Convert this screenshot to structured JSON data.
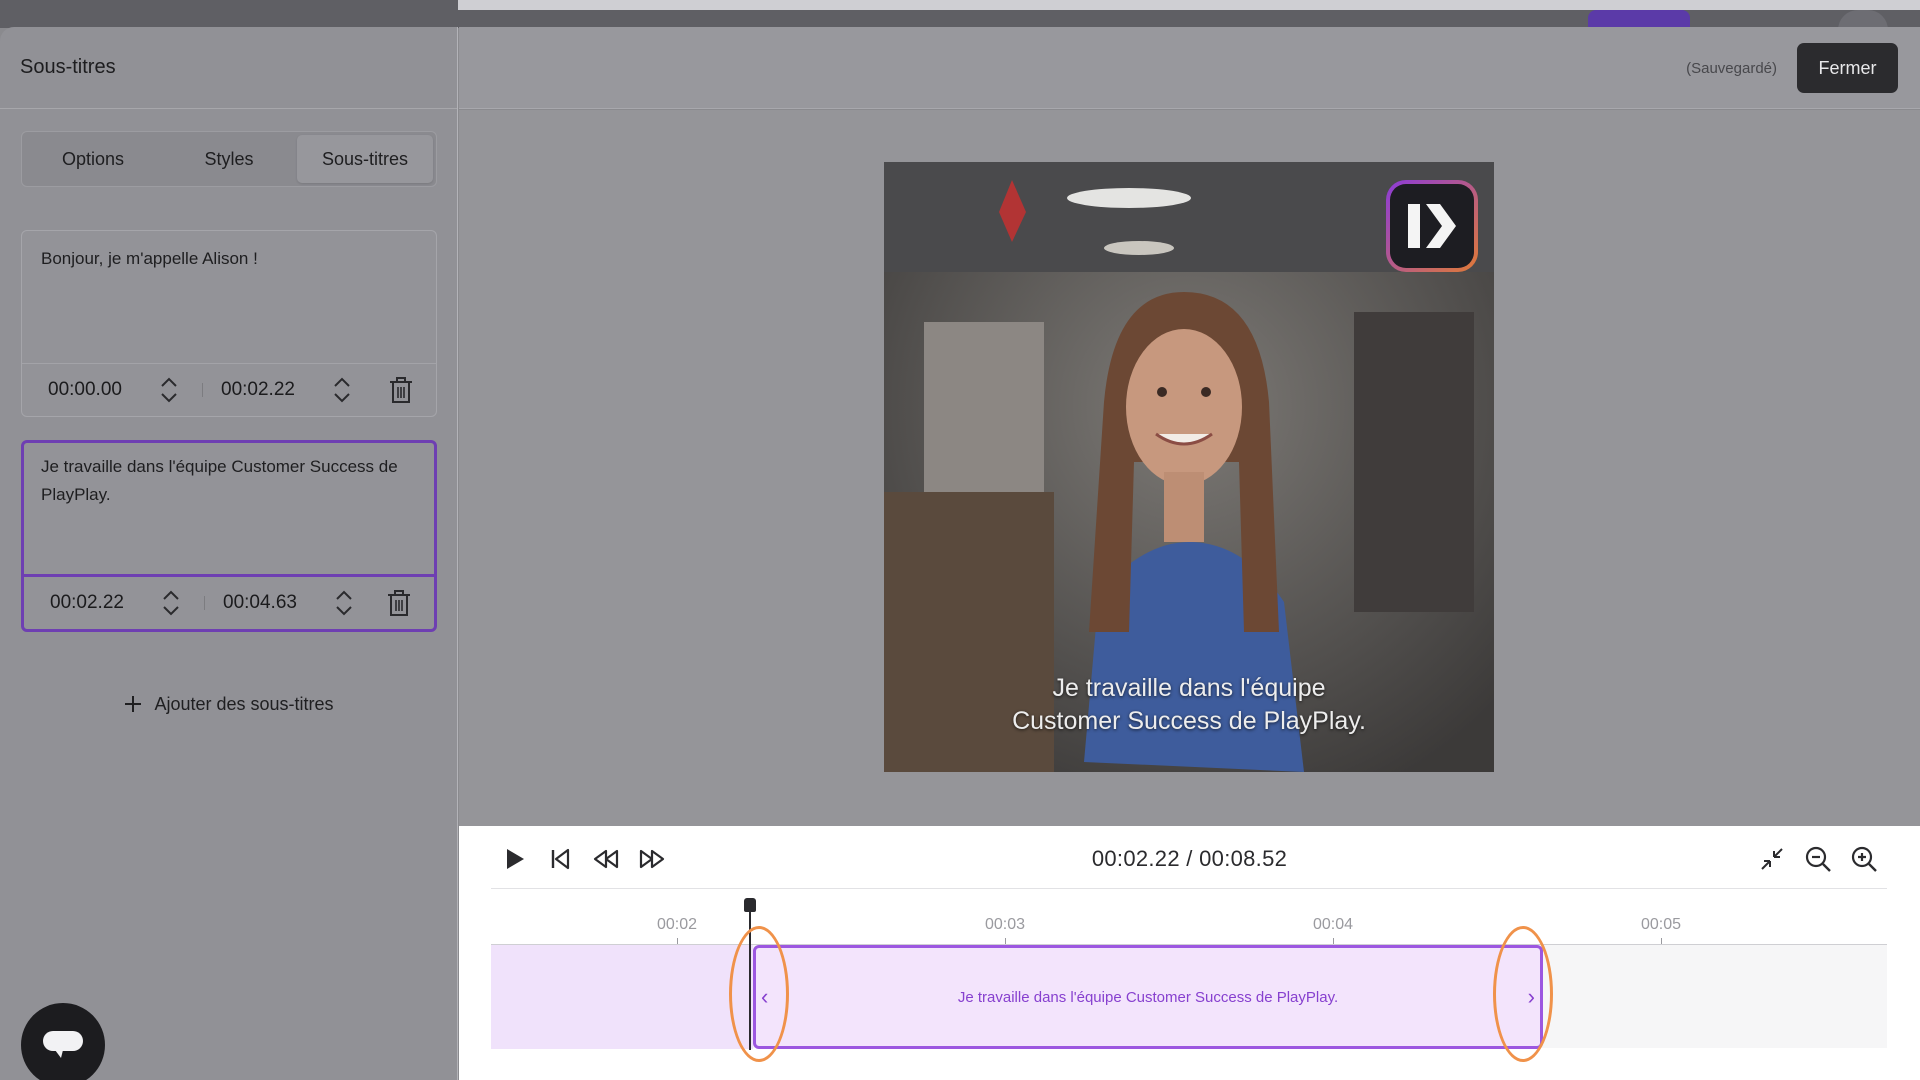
{
  "header": {
    "panel_title": "Sous-titres",
    "saved_status": "(Sauvegardé)",
    "close_label": "Fermer"
  },
  "tabs": [
    {
      "label": "Options",
      "active": false
    },
    {
      "label": "Styles",
      "active": false
    },
    {
      "label": "Sous-titres",
      "active": true
    }
  ],
  "subtitles": [
    {
      "text": "Bonjour, je m'appelle Alison !",
      "start": "00:00.00",
      "end": "00:02.22",
      "selected": false
    },
    {
      "text": "Je travaille dans l'équipe Customer Success de PlayPlay.",
      "start": "00:02.22",
      "end": "00:04.63",
      "selected": true
    }
  ],
  "add_subtitles_label": "Ajouter des sous-titres",
  "video": {
    "caption_line1": "Je travaille dans l'équipe",
    "caption_line2": "Customer Success de PlayPlay.",
    "logo": "playplay-logo"
  },
  "player": {
    "current_time": "00:02.22",
    "total_time": "00:08.52",
    "time_display": "00:02.22 / 00:08.52",
    "controls": [
      "play-icon",
      "skip-to-start-icon",
      "rewind-icon",
      "fast-forward-icon"
    ],
    "right_controls": [
      "collapse-icon",
      "zoom-out-icon",
      "zoom-in-icon"
    ]
  },
  "timeline": {
    "tick_labels": [
      "00:02",
      "00:03",
      "00:04",
      "00:05"
    ],
    "segment_text": "Je travaille dans l'équipe Customer Success de PlayPlay."
  },
  "colors": {
    "accent_purple": "#6e3fb2",
    "segment_fill": "#f3e4fc",
    "highlight_ring": "#f0924a"
  }
}
